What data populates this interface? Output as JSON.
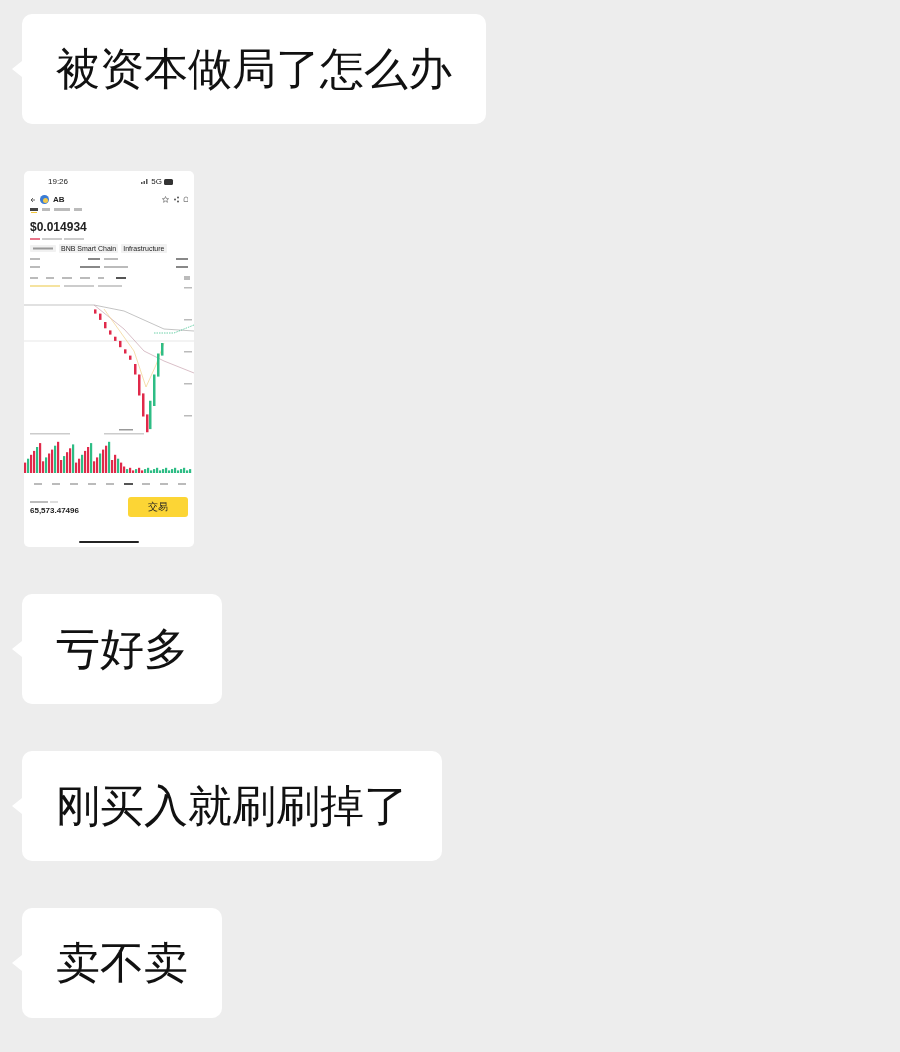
{
  "messages": [
    {
      "kind": "text",
      "text": "被资本做局了怎么办"
    },
    {
      "kind": "image",
      "screenshot": {
        "time": "19:26",
        "network": "5G",
        "token": "AB",
        "price": "$0.014934",
        "tags": [
          "BNB Smart Chain",
          "Infrastructure"
        ],
        "balance": "65,573.47496",
        "trade_button": "交易"
      }
    },
    {
      "kind": "text",
      "text": "亏好多"
    },
    {
      "kind": "text",
      "text": "刚买入就刷刷掉了"
    },
    {
      "kind": "text",
      "text": "卖不卖"
    }
  ]
}
